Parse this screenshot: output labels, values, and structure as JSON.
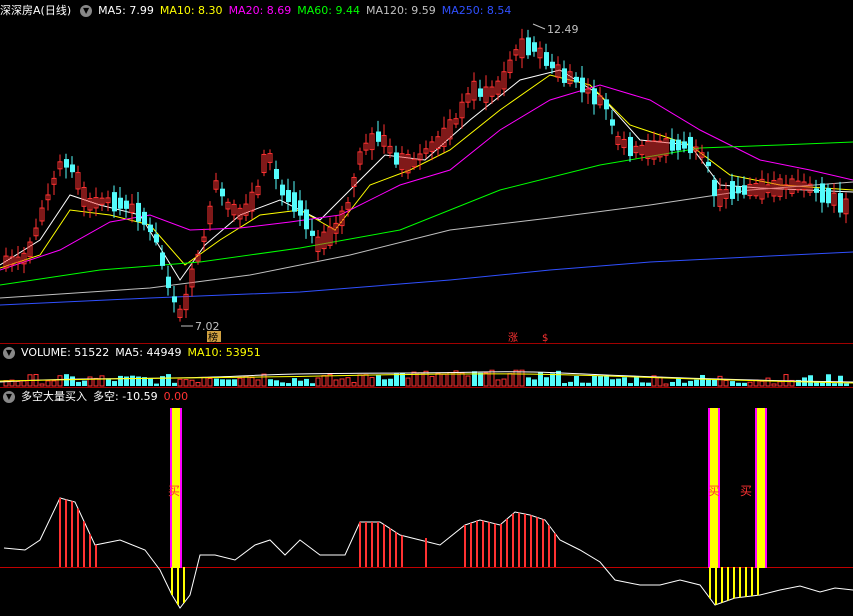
{
  "price_panel": {
    "stock_name": "深深房A",
    "period": "(日线)",
    "indicators": [
      {
        "label": "MA5: 7.99",
        "color": "#ffffff"
      },
      {
        "label": "MA10: 8.30",
        "color": "#ffff00"
      },
      {
        "label": "MA20: 8.69",
        "color": "#ff00ff"
      },
      {
        "label": "MA60: 9.44",
        "color": "#00ff00"
      },
      {
        "label": "MA120: 9.59",
        "color": "#c0c0c0"
      },
      {
        "label": "MA250: 8.54",
        "color": "#3050ff"
      }
    ],
    "high_label": "12.49",
    "low_label": "7.02",
    "markers": [
      "榜",
      "涨",
      "$"
    ]
  },
  "volume_panel": {
    "title": "VOLUME: 51522",
    "ma5": "MA5: 44949",
    "ma10": "MA10: 53951"
  },
  "indicator_panel": {
    "name": "多空大量买入",
    "value": "多空: -10.59",
    "extra": "0.00",
    "signal_label": "买"
  },
  "colors": {
    "up": "#ff3232",
    "down": "#54fcfc",
    "signal_yellow": "#ffff00",
    "signal_magenta": "#ff00ff"
  }
}
